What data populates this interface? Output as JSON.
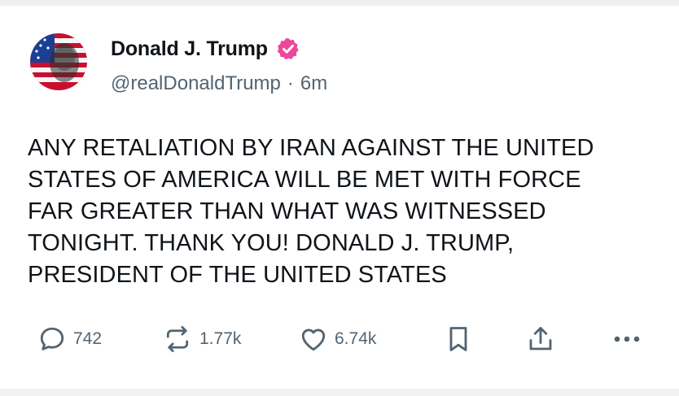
{
  "post": {
    "author": {
      "display_name": "Donald J. Trump",
      "handle": "@realDonaldTrump",
      "separator": "·",
      "time_ago": "6m",
      "verified": true,
      "verified_color": "#ec4899"
    },
    "text_lines": [
      "ANY RETALIATION BY IRAN AGAINST THE UNITED",
      "STATES OF AMERICA WILL BE MET WITH FORCE",
      "FAR GREATER THAN WHAT WAS WITNESSED",
      "TONIGHT. THANK YOU! DONALD J. TRUMP,",
      "PRESIDENT OF THE UNITED STATES"
    ],
    "actions": {
      "replies": "742",
      "reposts": "1.77k",
      "likes": "6.74k"
    },
    "icons": [
      "reply-icon",
      "repost-icon",
      "like-icon",
      "bookmark-icon",
      "share-icon",
      "more-icon"
    ]
  },
  "colors": {
    "text": "#0f1419",
    "secondary": "#536471",
    "verified": "#ec4899"
  }
}
